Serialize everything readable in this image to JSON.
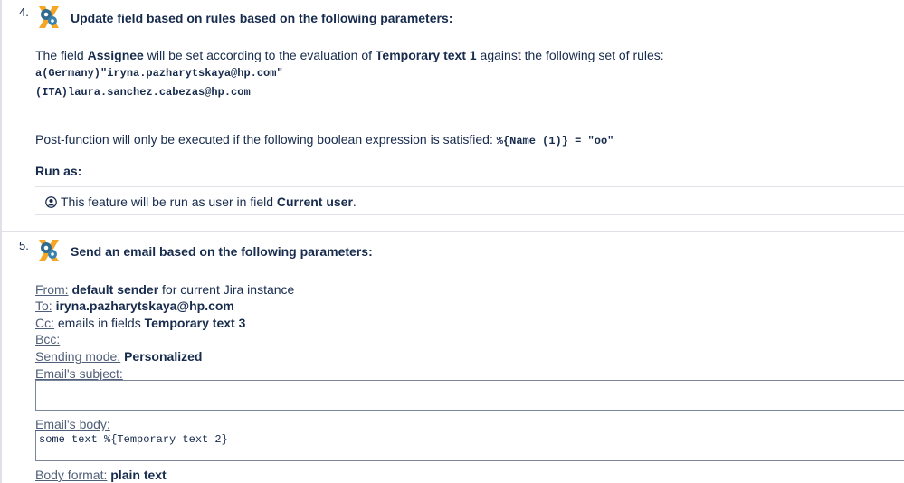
{
  "step4": {
    "number": "4.",
    "heading": "Update field based on rules based on the following parameters:",
    "desc_pre": "The field ",
    "field_name": "Assignee",
    "desc_mid": " will be set according to the evaluation of ",
    "source_field": "Temporary text 1",
    "desc_post": " against the following set of rules:",
    "rules": [
      "a(Germany)\"iryna.pazharytskaya@hp.com\"",
      "(ITA)laura.sanchez.cabezas@hp.com"
    ],
    "condition_pre": "Post-function will only be executed if the following boolean expression is satisfied: ",
    "condition_expr": "%{Name (1)} = \"oo\"",
    "run_as_label": "Run as:",
    "run_as_pre": "This feature will be run as user in field ",
    "run_as_value": "Current user",
    "run_as_post": "."
  },
  "step5": {
    "number": "5.",
    "heading": "Send an email based on the following parameters:",
    "from_label": "From:",
    "from_value": "default sender",
    "from_post": " for current Jira instance",
    "to_label": "To:",
    "to_value": "iryna.pazharytskaya@hp.com",
    "cc_label": "Cc:",
    "cc_pre": " emails in fields ",
    "cc_value": "Temporary text 3",
    "bcc_label": "Bcc:",
    "mode_label": "Sending mode:",
    "mode_value": "Personalized",
    "subject_label": "Email's subject:",
    "subject_value": "",
    "body_label": "Email's body:",
    "body_value": "some text %{Temporary text 2}",
    "format_label": "Body format:",
    "format_value": "plain text"
  },
  "icons": {
    "logo": "jwt-gears-x-logo-icon",
    "run_as": "user-circle-icon"
  },
  "colors": {
    "text": "#172b4d",
    "logo_x": "#f5a623",
    "logo_gear": "#2f6b8f"
  }
}
